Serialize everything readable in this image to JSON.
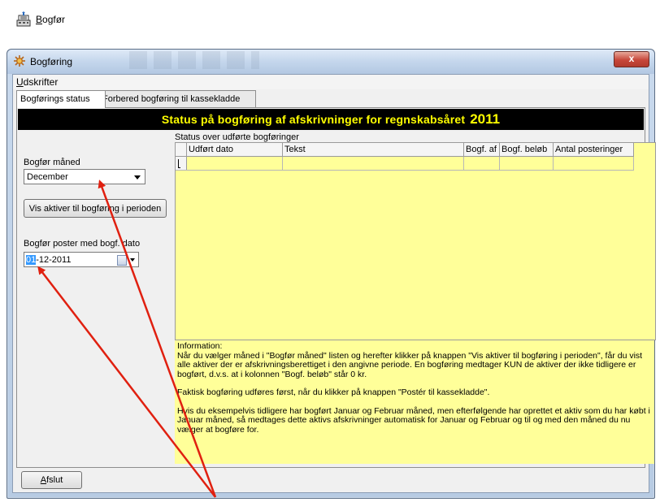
{
  "toolbar": {
    "bogfor_label": "Bogfør",
    "bogfor_first": "B",
    "bogfor_rest": "ogfør"
  },
  "window": {
    "title": "Bogføring",
    "close_label": "x"
  },
  "menu": {
    "udskrifter_first": "U",
    "udskrifter_rest": "dskrifter"
  },
  "tabs": [
    {
      "label": "Bogførings status"
    },
    {
      "label": "Forbered bogføring til kassekladde"
    }
  ],
  "banner": {
    "text": "Status på bogføring af afskrivninger for regnskabsåret",
    "year": "2011"
  },
  "left": {
    "month_label": "Bogfør måned",
    "month_value": "December",
    "show_button": "Vis aktiver til bogføring i perioden",
    "date_label": "Bogfør poster med bogf. dato",
    "date_selected": "01",
    "date_rest": "-12-2011"
  },
  "grid": {
    "title": "Status over udførte bogføringer",
    "columns": [
      "Udført dato",
      "Tekst",
      "Bogf. af",
      "Bogf. beløb",
      "Antal posteringer"
    ]
  },
  "info": {
    "heading": "Information:",
    "p1": "Når du vælger måned i \"Bogfør måned\" listen og herefter klikker på knappen \"Vis aktiver til bogføring i perioden\", får du vist alle aktiver der er afskrivningsberettiget i den angivne periode. En bogføring medtager KUN de aktiver der ikke tidligere er bogført, d.v.s. at i kolonnen \"Bogf. beløb\" står 0 kr.",
    "p2": "Faktisk bogføring udføres først, når du klikker på knappen \"Postér til kassekladde\".",
    "p3": "Hvis du eksempelvis tidligere har bogført Januar og Februar måned, men efterfølgende har oprettet et aktiv som du har købt i Januar måned, så medtages dette aktivs afskrivninger automatisk for Januar og Februar og til og med den måned du nu vælger at bogføre for."
  },
  "footer": {
    "afslut_first": "A",
    "afslut_rest": "fslut"
  },
  "colors": {
    "banner_bg": "#000000",
    "banner_text": "#ffff00",
    "grid_bg": "#ffff99",
    "arrow": "#e02010"
  }
}
